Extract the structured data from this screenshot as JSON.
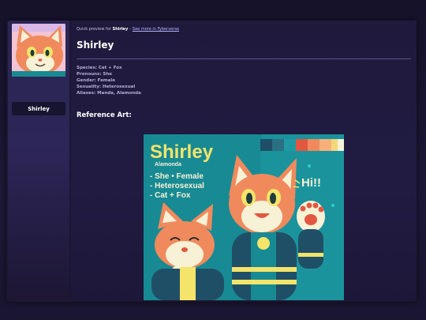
{
  "character": {
    "name": "Shirley",
    "sidebar_name": "Shirley"
  },
  "preview": {
    "prefix": "Quick preview for",
    "name": "Shirley",
    "separator": "–",
    "link_text": "See more in Fyberverse"
  },
  "info": {
    "species": "Species: Cat + Fox",
    "pronouns": "Pronouns: She",
    "gender": "Gender: Female",
    "sexuality": "Sexuality: Heterosexual",
    "aliases": "Aliases: Manda, Alamonda"
  },
  "reference_section": {
    "title": "Reference Art:"
  },
  "reference_art": {
    "title": "Shirley",
    "subtitle": "Alamonda",
    "bullets": [
      "- She • Female",
      "- Heterosexual",
      "- Cat + Fox"
    ],
    "greeting": "Hi!!",
    "palette": [
      "#1f4f66",
      "#2b6f82",
      "#1f9aa3",
      "#e2573f",
      "#f08a5d",
      "#f7b07a",
      "#f4d77a",
      "#f7f1d6"
    ]
  },
  "colors": {
    "background": "#16122a",
    "sidebar": "#2a2552",
    "panel": "#1f1a3c",
    "accent_link": "#b8b4ff",
    "art_teal": "#178a94",
    "art_yellow": "#f4e46a"
  }
}
